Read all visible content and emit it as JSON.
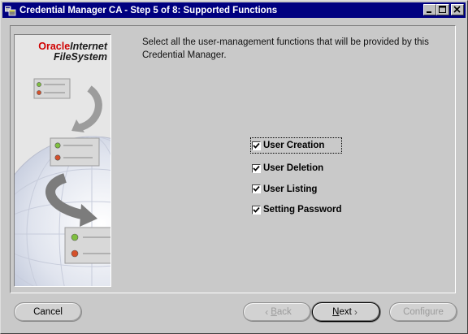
{
  "window": {
    "title": "Credential Manager CA - Step 5 of 8: Supported Functions",
    "controls": {
      "minimize": "minimize-icon",
      "maximize": "maximize-icon",
      "close": "close-icon"
    }
  },
  "logo": {
    "line1_red": "Oracle",
    "line1_dark": "Internet",
    "line2": "FileSystem"
  },
  "instruction": "Select all the user-management functions that will be provided by this Credential Manager.",
  "functions": [
    {
      "label": "User Creation",
      "checked": true
    },
    {
      "label": "User Deletion",
      "checked": true
    },
    {
      "label": "User Listing",
      "checked": true
    },
    {
      "label": "Setting Password",
      "checked": true
    }
  ],
  "buttons": {
    "cancel": "Cancel",
    "back_mnemonic": "B",
    "back_rest": "ack",
    "next_mnemonic": "N",
    "next_rest": "ext",
    "configure": "Configure"
  },
  "colors": {
    "titlebar": "#000080",
    "oracle_red": "#d00000"
  }
}
